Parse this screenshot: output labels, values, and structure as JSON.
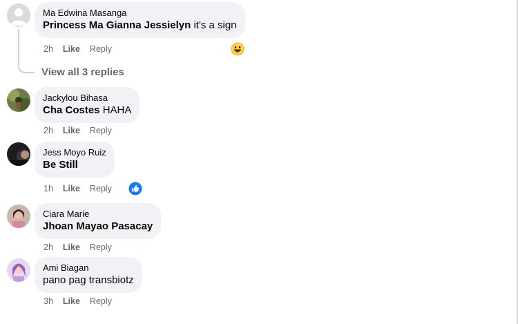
{
  "comments": [
    {
      "author": "Ma Edwina Masanga",
      "tag": "Princess Ma Gianna Jessielyn",
      "text": " it's a sign",
      "time": "2h",
      "like": "Like",
      "reply": "Reply",
      "reaction": "laugh-reaction-icon"
    },
    {
      "author": "Jackylou Bihasa",
      "tag": "Cha Costes",
      "text": " HAHA",
      "time": "2h",
      "like": "Like",
      "reply": "Reply"
    },
    {
      "author": "Jess Moyo Ruiz",
      "tag": "Be Still",
      "text": "",
      "time": "1h",
      "like": "Like",
      "reply": "Reply",
      "reaction": "like-reaction-icon"
    },
    {
      "author": "Ciara Marie",
      "tag": "Jhoan Mayao Pasacay",
      "text": "",
      "time": "2h",
      "like": "Like",
      "reply": "Reply"
    },
    {
      "author": "Ami Biagan",
      "tag": "",
      "text": "pano pag transbiotz",
      "time": "3h",
      "like": "Like",
      "reply": "Reply"
    }
  ],
  "thread": {
    "view_replies": "View all 3 replies"
  },
  "colors": {
    "bubble": "#f0f2f5",
    "meta_text": "#65676b",
    "like_blue": "#1877f2",
    "laugh_yellow": "#f7b125"
  }
}
